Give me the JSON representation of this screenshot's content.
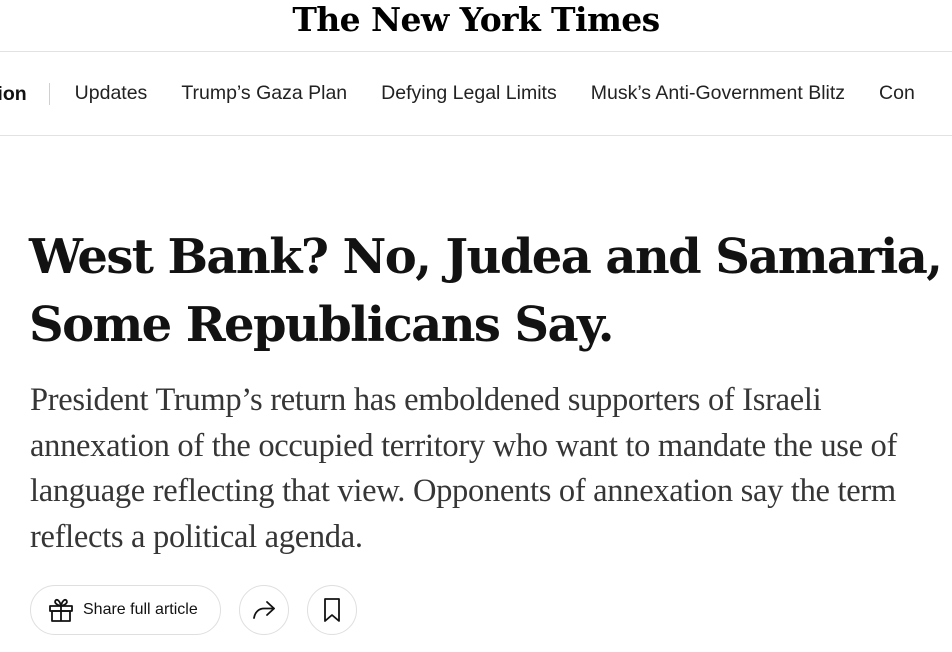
{
  "masthead": {
    "logo_text": "The New York Times"
  },
  "nav": {
    "section_label": "Trump Administration",
    "section_visible": "tration",
    "items": [
      {
        "label": "Updates"
      },
      {
        "label": "Trump’s Gaza Plan"
      },
      {
        "label": "Defying Legal Limits"
      },
      {
        "label": "Musk’s Anti-Government Blitz"
      },
      {
        "label": "Con"
      }
    ]
  },
  "article": {
    "headline": "West Bank? No, Judea and Samaria, Some Republicans Say.",
    "summary": "President Trump’s return has emboldened supporters of Israeli annexation of the occupied territory who want to mandate the use of language reflecting that view. Opponents of annexation say the term reflects a political agenda."
  },
  "actions": {
    "share_label": "Share full article",
    "share_icon": "gift-icon",
    "forward_icon": "share-arrow-icon",
    "save_icon": "bookmark-icon"
  }
}
